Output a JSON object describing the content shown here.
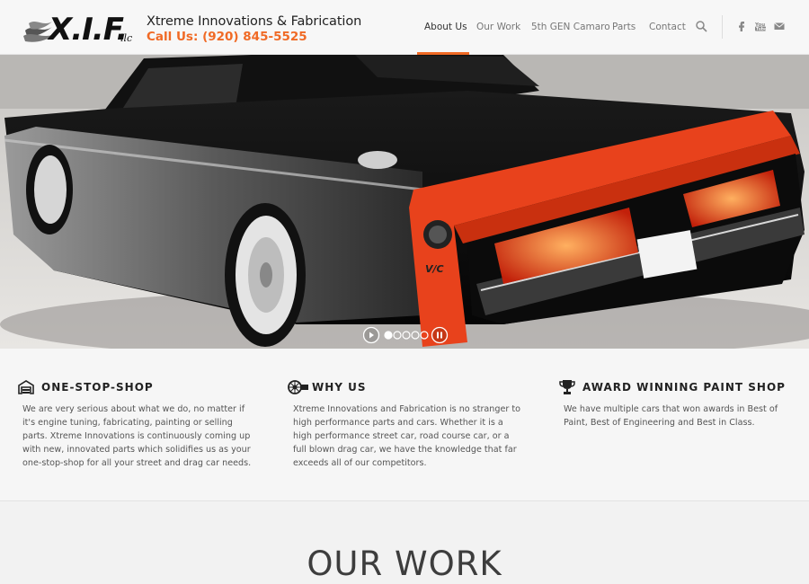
{
  "header": {
    "brand_name": "Xtreme Innovations & Fabrication",
    "phone": "Call Us: (920) 845-5525",
    "logo_text": "X.I.F. llc",
    "nav": [
      {
        "label": "About Us",
        "active": true
      },
      {
        "label": "Our Work",
        "active": false
      },
      {
        "label": "5th GEN Camaro",
        "active": false
      },
      {
        "label": "Parts",
        "active": false
      },
      {
        "label": "Contact",
        "active": false
      }
    ],
    "icons": [
      "search-icon",
      "facebook-icon",
      "youtube-icon",
      "mail-icon"
    ]
  },
  "hero": {
    "slide_count": 5,
    "active_slide": 1
  },
  "features": [
    {
      "title": "ONE-STOP-SHOP",
      "icon": "garage-icon",
      "text": "We are very serious about what we do, no matter if it's engine tuning, fabricating, painting or selling parts. Xtreme Innovations is continuously coming up with new, innovated parts which solidifies us as your one-stop-shop for all your street and drag car needs."
    },
    {
      "title": "WHY US",
      "icon": "turbo-icon",
      "text": "Xtreme Innovations and Fabrication is no stranger to high performance parts and cars. Whether it is a high performance street car, road course car, or a full blown drag car, we have the knowledge that far exceeds all of our competitors."
    },
    {
      "title": "AWARD WINNING PAINT SHOP",
      "icon": "trophy-icon",
      "text": "We have multiple cars that won awards in Best of Paint, Best of Engineering and Best in Class."
    }
  ],
  "work": {
    "title": "OUR WORK"
  },
  "colors": {
    "accent": "#f06a25",
    "text_dark": "#222222",
    "background": "#f6f6f6"
  }
}
